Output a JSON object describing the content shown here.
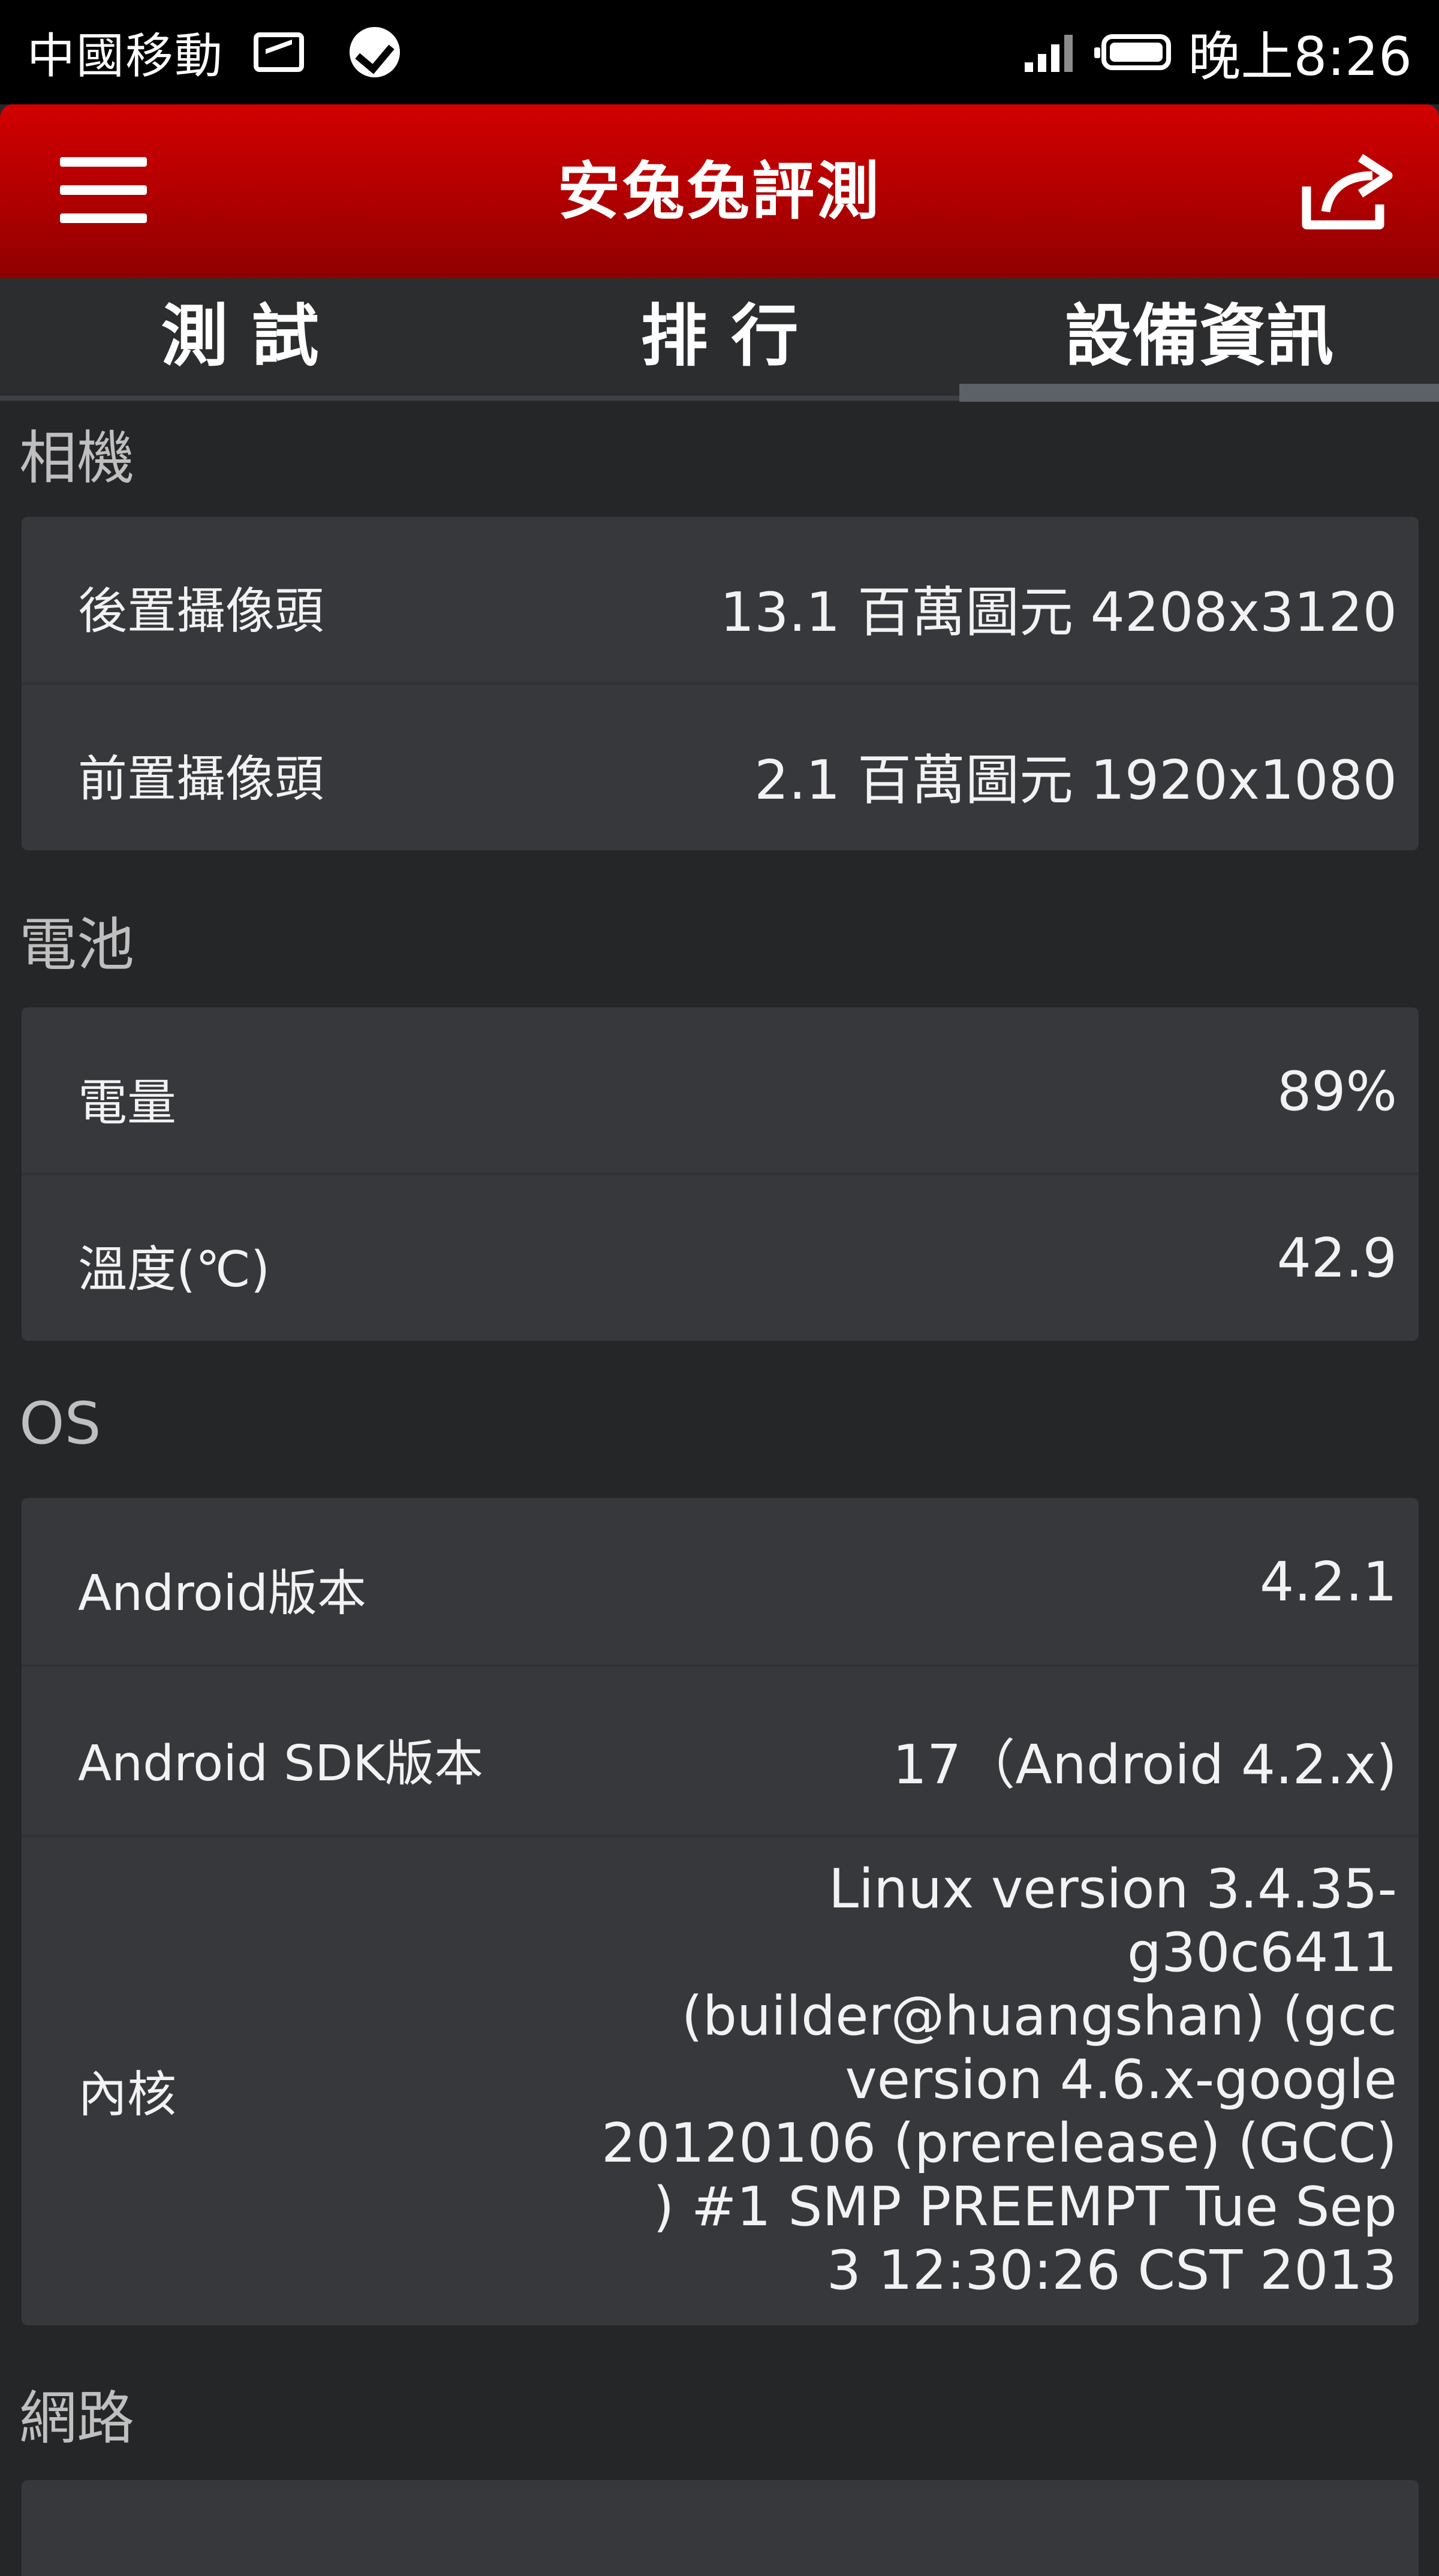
{
  "status_bar": {
    "carrier": "中國移動",
    "time": "晚上8:26",
    "icons": [
      "picture-icon",
      "check-icon",
      "signal-icon",
      "battery-icon"
    ]
  },
  "app_bar": {
    "title": "安兔兔評測",
    "menu_icon": "menu-icon",
    "share_icon": "share-icon",
    "color": "#c40000"
  },
  "tabs": [
    {
      "label": "測 試"
    },
    {
      "label": "排 行"
    },
    {
      "label": "設備資訊"
    }
  ],
  "selected_tab": "設備資訊",
  "sections": {
    "camera": {
      "title": "相機",
      "rows": [
        {
          "label": "後置攝像頭",
          "value": "13.1 百萬圖元   4208x3120"
        },
        {
          "label": "前置攝像頭",
          "value": "2.1 百萬圖元   1920x1080"
        }
      ]
    },
    "battery": {
      "title": "電池",
      "rows": [
        {
          "label": "電量",
          "value": "89%"
        },
        {
          "label": "溫度(℃)",
          "value": "42.9"
        }
      ]
    },
    "os": {
      "title": "OS",
      "rows": [
        {
          "label": "Android版本",
          "value": "4.2.1"
        },
        {
          "label": "Android SDK版本",
          "value": "17（Android 4.2.x)"
        },
        {
          "label": "內核",
          "value": "Linux version 3.4.35-\ng30c6411\n(builder@huangshan) (gcc\nversion 4.6.x-google\n20120106 (prerelease) (GCC)\n) #1 SMP PREEMPT Tue Sep\n3 12:30:26 CST 2013"
        }
      ]
    },
    "network": {
      "title": "網路"
    }
  }
}
